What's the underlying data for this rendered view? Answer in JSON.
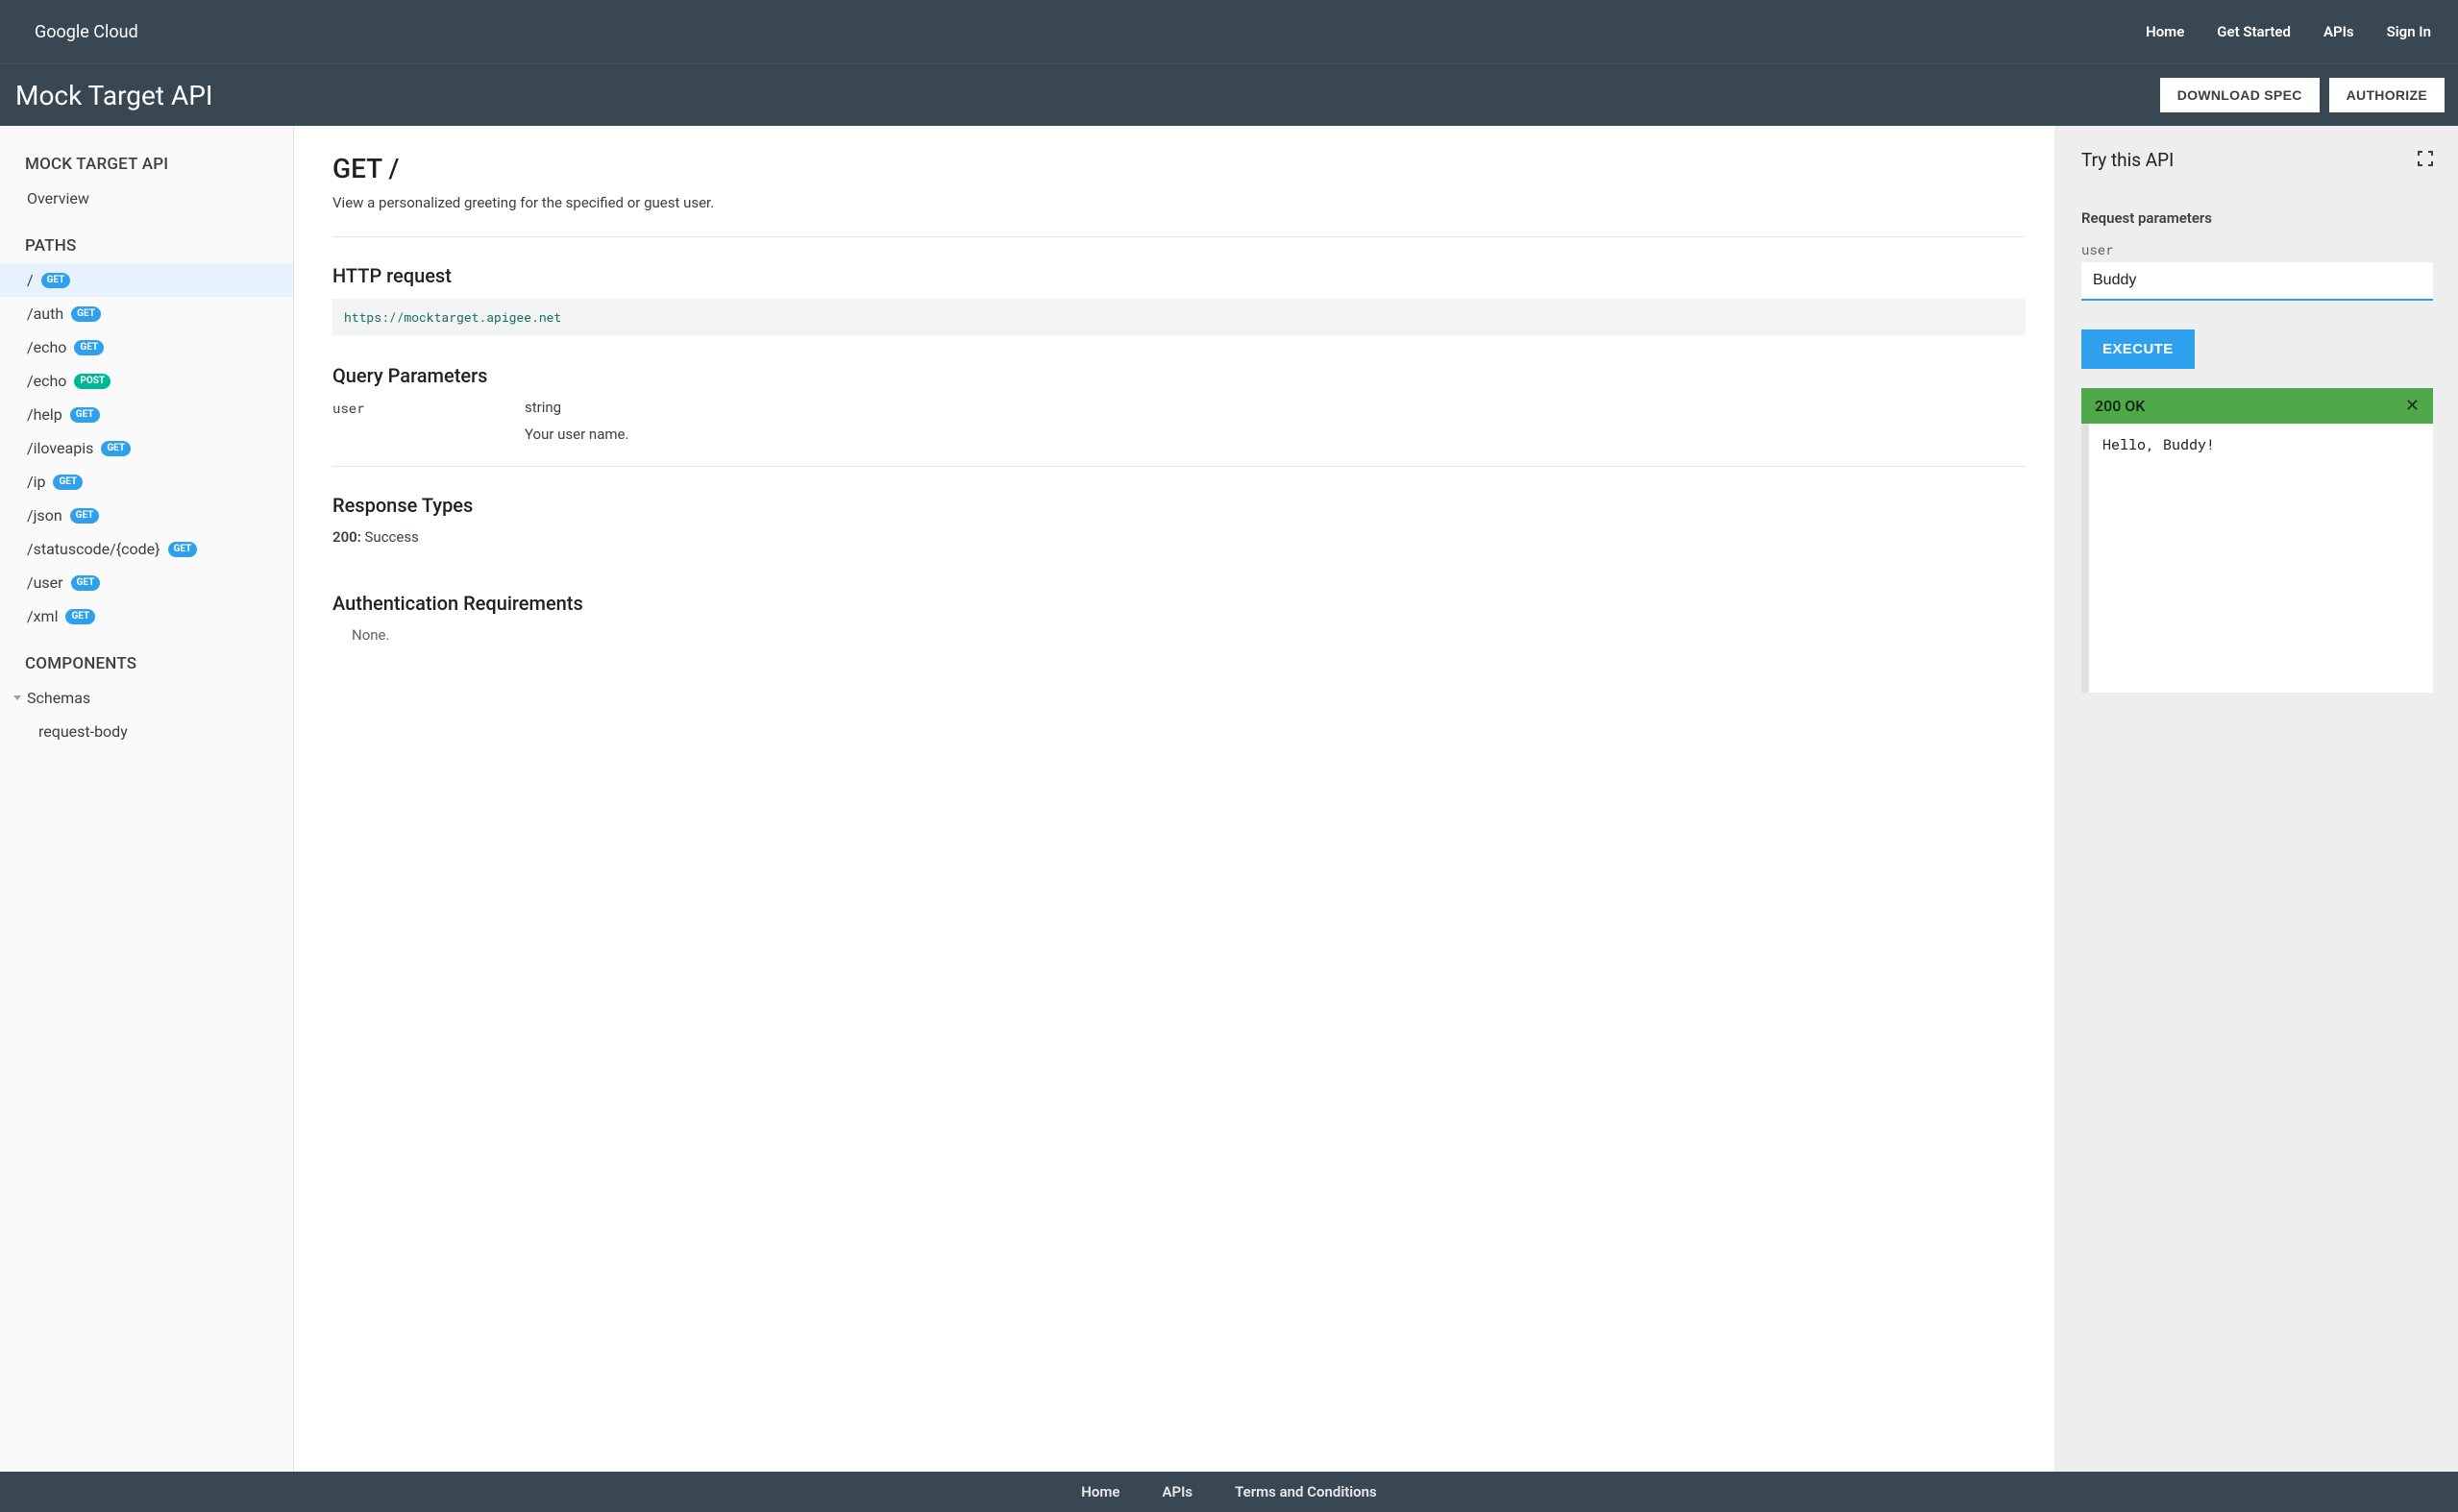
{
  "brand": "Google Cloud",
  "topnav": {
    "home": "Home",
    "get_started": "Get Started",
    "apis": "APIs",
    "sign_in": "Sign In"
  },
  "subheader": {
    "title": "Mock Target API",
    "download": "DOWNLOAD SPEC",
    "authorize": "AUTHORIZE"
  },
  "sidebar": {
    "api_heading": "MOCK TARGET API",
    "overview": "Overview",
    "paths_heading": "PATHS",
    "paths": [
      {
        "path": "/",
        "method": "GET",
        "badge_class": "bg-get",
        "active": true
      },
      {
        "path": "/auth",
        "method": "GET",
        "badge_class": "bg-get"
      },
      {
        "path": "/echo",
        "method": "GET",
        "badge_class": "bg-get"
      },
      {
        "path": "/echo",
        "method": "POST",
        "badge_class": "bg-post"
      },
      {
        "path": "/help",
        "method": "GET",
        "badge_class": "bg-get"
      },
      {
        "path": "/iloveapis",
        "method": "GET",
        "badge_class": "bg-get"
      },
      {
        "path": "/ip",
        "method": "GET",
        "badge_class": "bg-get"
      },
      {
        "path": "/json",
        "method": "GET",
        "badge_class": "bg-get"
      },
      {
        "path": "/statuscode/{code}",
        "method": "GET",
        "badge_class": "bg-get"
      },
      {
        "path": "/user",
        "method": "GET",
        "badge_class": "bg-get"
      },
      {
        "path": "/xml",
        "method": "GET",
        "badge_class": "bg-get"
      }
    ],
    "components_heading": "COMPONENTS",
    "schemas": "Schemas",
    "schema_items": [
      "request-body"
    ]
  },
  "main": {
    "title": "GET /",
    "description": "View a personalized greeting for the specified or guest user.",
    "http_heading": "HTTP request",
    "http_url": "https://mocktarget.apigee.net",
    "query_heading": "Query Parameters",
    "params": [
      {
        "name": "user",
        "type": "string",
        "desc": "Your user name."
      }
    ],
    "response_heading": "Response Types",
    "responses": [
      {
        "code": "200:",
        "label": "Success"
      }
    ],
    "auth_heading": "Authentication Requirements",
    "auth_none": "None."
  },
  "try": {
    "title": "Try this API",
    "req_params_heading": "Request parameters",
    "param_name": "user",
    "param_value": "Buddy",
    "execute": "EXECUTE",
    "status": "200 OK",
    "body": "Hello, Buddy!"
  },
  "footer": {
    "home": "Home",
    "apis": "APIs",
    "terms": "Terms and Conditions"
  }
}
